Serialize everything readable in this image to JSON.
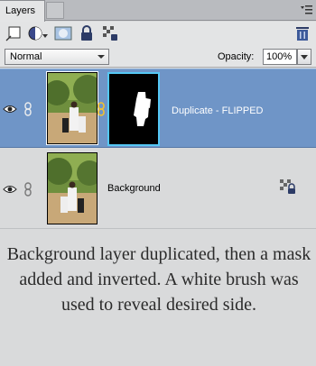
{
  "panel": {
    "tab_label": "Layers",
    "menu_icon": "panel-menu-icon"
  },
  "toolbar": {
    "icons": [
      "new-layer-icon",
      "fill-adjustment-icon",
      "add-mask-icon",
      "lock-all-icon",
      "lock-transparency-icon",
      "trash-icon"
    ]
  },
  "options": {
    "blend_mode": "Normal",
    "opacity_label": "Opacity:",
    "opacity_value": "100%"
  },
  "layers": [
    {
      "name": "Duplicate - FLIPPED",
      "selected": true,
      "visible": true,
      "has_mask": true
    },
    {
      "name": "Background",
      "selected": false,
      "visible": true,
      "locked": true
    }
  ],
  "caption": {
    "text": "Background layer duplicated, then a mask added and inverted. A white brush was used to reveal desired side."
  },
  "colors": {
    "selected_row": "#6f95c7",
    "mask_border": "#55c8f5",
    "panel_bg": "#d9dadb"
  }
}
